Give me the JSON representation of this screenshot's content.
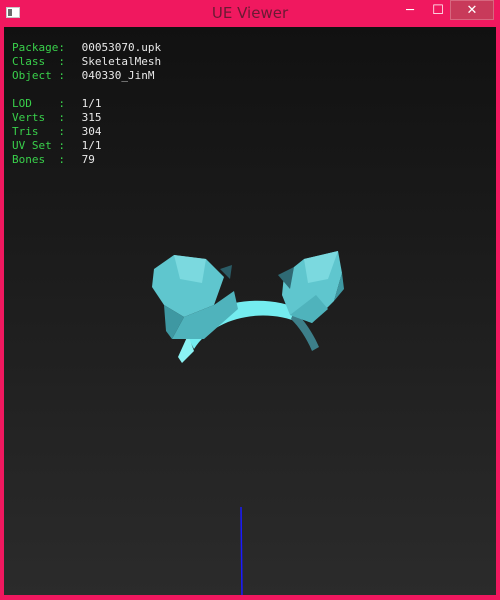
{
  "window": {
    "title": "UE Viewer",
    "controls": {
      "minimize": "─",
      "maximize": "☐",
      "close": "✕"
    },
    "title_color": "#f0185f"
  },
  "info": {
    "package": {
      "label": "Package:",
      "value": "00053070.upk"
    },
    "class": {
      "label": "Class  :",
      "value": "SkeletalMesh"
    },
    "object": {
      "label": "Object :",
      "value": "040330_JinM"
    },
    "lod": {
      "label": "LOD    :",
      "value": "1/1"
    },
    "verts": {
      "label": "Verts  :",
      "value": "315"
    },
    "tris": {
      "label": "Tris   :",
      "value": "304"
    },
    "uvset": {
      "label": "UV Set :",
      "value": "1/1"
    },
    "bones": {
      "label": "Bones  :",
      "value": "79"
    }
  },
  "colors": {
    "label": "#39d04b",
    "value": "#e8e8e8",
    "mesh": "#6fd6dc",
    "axis": "#1a1aff"
  }
}
